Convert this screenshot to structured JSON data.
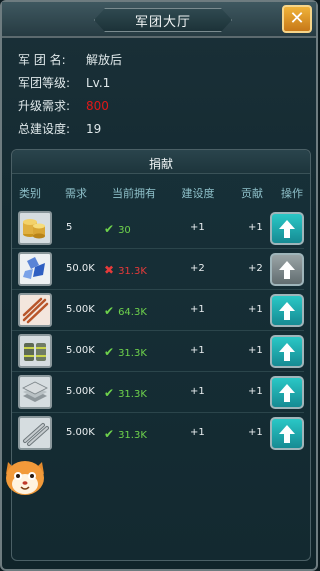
{
  "window": {
    "title": "军团大厅"
  },
  "info": {
    "name_label": "军 团 名:",
    "name_value": "解放后",
    "level_label": "军团等级:",
    "level_value": "Lv.1",
    "upgrade_label": "升级需求:",
    "upgrade_value": "800",
    "build_label": "总建设度:",
    "build_value": "19"
  },
  "donate": {
    "title": "捐献",
    "columns": [
      "类别",
      "需求",
      "当前拥有",
      "建设度",
      "贡献",
      "操作"
    ],
    "rows": [
      {
        "icon": "gold-coins-icon",
        "need": "5",
        "have": "30",
        "ok": true,
        "build": "+1",
        "contrib": "+1"
      },
      {
        "icon": "crystal-icon",
        "need": "50.0K",
        "have": "31.3K",
        "ok": false,
        "build": "+2",
        "contrib": "+2"
      },
      {
        "icon": "copper-rods-icon",
        "need": "5.00K",
        "have": "64.3K",
        "ok": true,
        "build": "+1",
        "contrib": "+1"
      },
      {
        "icon": "oil-barrels-icon",
        "need": "5.00K",
        "have": "31.3K",
        "ok": true,
        "build": "+1",
        "contrib": "+1"
      },
      {
        "icon": "steel-plates-icon",
        "need": "5.00K",
        "have": "31.3K",
        "ok": true,
        "build": "+1",
        "contrib": "+1"
      },
      {
        "icon": "steel-pipes-icon",
        "need": "5.00K",
        "have": "31.3K",
        "ok": true,
        "build": "+1",
        "contrib": "+1"
      }
    ]
  },
  "colors": {
    "accent": "#20b0b3",
    "warning": "#e01818",
    "ok": "#6ed24c",
    "bad": "#e63a3a"
  }
}
